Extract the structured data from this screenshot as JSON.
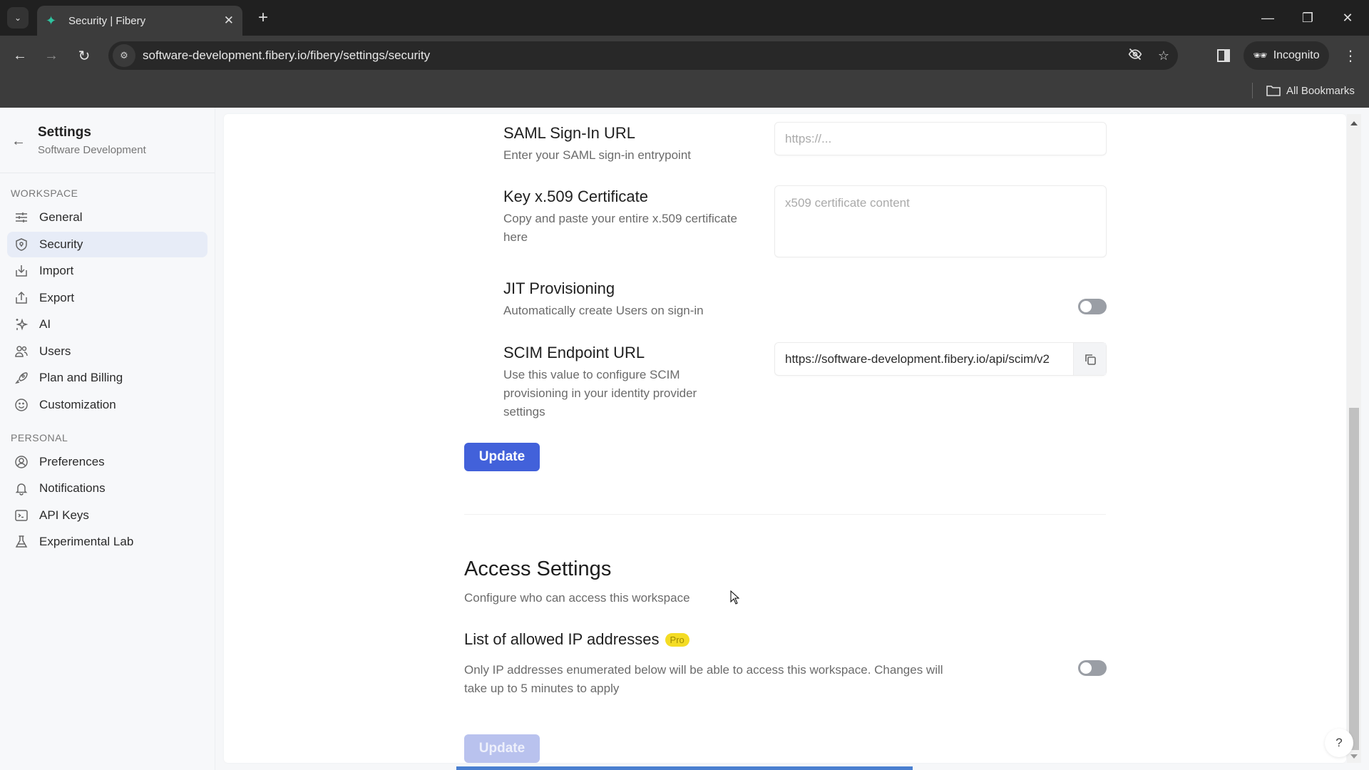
{
  "browser": {
    "tab_title": "Security | Fibery",
    "url": "software-development.fibery.io/fibery/settings/security",
    "incognito_label": "Incognito",
    "bookmarks_label": "All Bookmarks"
  },
  "sidebar": {
    "title": "Settings",
    "subtitle": "Software Development",
    "sections": [
      {
        "label": "WORKSPACE",
        "items": [
          {
            "label": "General",
            "icon": "sliders-icon",
            "active": false
          },
          {
            "label": "Security",
            "icon": "shield-icon",
            "active": true
          },
          {
            "label": "Import",
            "icon": "import-icon",
            "active": false
          },
          {
            "label": "Export",
            "icon": "export-icon",
            "active": false
          },
          {
            "label": "AI",
            "icon": "sparkles-icon",
            "active": false
          },
          {
            "label": "Users",
            "icon": "users-icon",
            "active": false
          },
          {
            "label": "Plan and Billing",
            "icon": "rocket-icon",
            "active": false
          },
          {
            "label": "Customization",
            "icon": "smiley-icon",
            "active": false
          }
        ]
      },
      {
        "label": "PERSONAL",
        "items": [
          {
            "label": "Preferences",
            "icon": "user-circle-icon",
            "active": false
          },
          {
            "label": "Notifications",
            "icon": "bell-icon",
            "active": false
          },
          {
            "label": "API Keys",
            "icon": "terminal-icon",
            "active": false
          },
          {
            "label": "Experimental Lab",
            "icon": "flask-icon",
            "active": false
          }
        ]
      }
    ]
  },
  "saml": {
    "sign_in_url": {
      "label": "SAML Sign-In URL",
      "description": "Enter your SAML sign-in entrypoint",
      "placeholder": "https://...",
      "value": ""
    },
    "certificate": {
      "label": "Key x.509 Certificate",
      "description": "Copy and paste your entire x.509 certificate here",
      "placeholder": "x509 certificate content",
      "value": ""
    },
    "jit": {
      "label": "JIT Provisioning",
      "description": "Automatically create Users on sign-in",
      "enabled": false
    },
    "scim": {
      "label": "SCIM Endpoint URL",
      "description": "Use this value to configure SCIM provisioning in your identity provider settings",
      "value": "https://software-development.fibery.io/api/scim/v2"
    },
    "update_label": "Update"
  },
  "access": {
    "title": "Access Settings",
    "description": "Configure who can access this workspace",
    "ip_list": {
      "label": "List of allowed IP addresses",
      "badge": "Pro",
      "description": "Only IP addresses enumerated below will be able to access this workspace. Changes will take up to 5 minutes to apply",
      "enabled": false
    },
    "update_label": "Update",
    "update_disabled": true
  },
  "help_label": "?",
  "colors": {
    "primary": "#4261da",
    "pro_badge": "#f4dc24",
    "active_nav": "#e7ecf7"
  }
}
